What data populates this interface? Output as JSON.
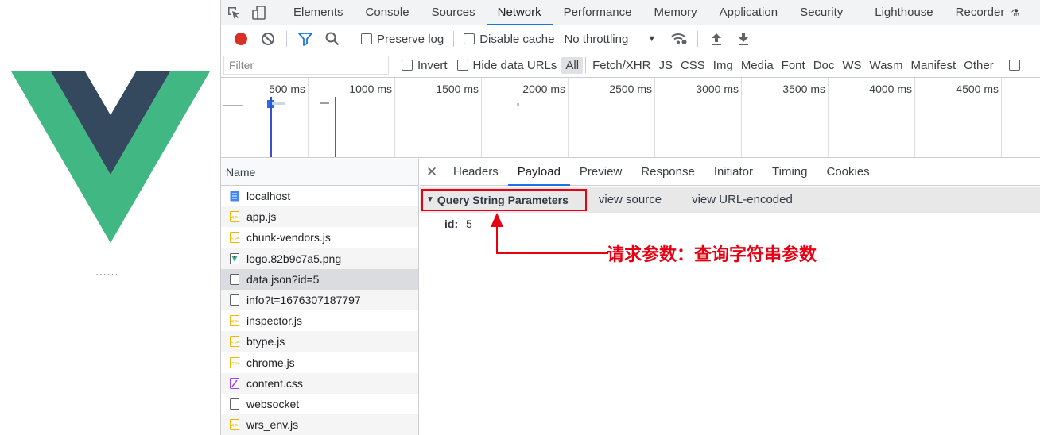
{
  "app": {
    "text": "......"
  },
  "devtools": {
    "tabs": [
      "Elements",
      "Console",
      "Sources",
      "Network",
      "Performance",
      "Memory",
      "Application",
      "Security",
      "Lighthouse",
      "Recorder"
    ],
    "active_tab": "Network",
    "toolbar": {
      "preserve_log": "Preserve log",
      "disable_cache": "Disable cache",
      "throttling": "No throttling"
    },
    "filter": {
      "placeholder": "Filter",
      "invert": "Invert",
      "hide_data_urls": "Hide data URLs",
      "types": [
        "All",
        "Fetch/XHR",
        "JS",
        "CSS",
        "Img",
        "Media",
        "Font",
        "Doc",
        "WS",
        "Wasm",
        "Manifest",
        "Other"
      ]
    },
    "timeline_ticks": [
      "500 ms",
      "1000 ms",
      "1500 ms",
      "2000 ms",
      "2500 ms",
      "3000 ms",
      "3500 ms",
      "4000 ms",
      "4500 ms"
    ],
    "name_header": "Name",
    "requests": [
      {
        "name": "localhost",
        "type": "doc"
      },
      {
        "name": "app.js",
        "type": "script"
      },
      {
        "name": "chunk-vendors.js",
        "type": "script"
      },
      {
        "name": "logo.82b9c7a5.png",
        "type": "image"
      },
      {
        "name": "data.json?id=5",
        "type": "xhr"
      },
      {
        "name": "info?t=1676307187797",
        "type": "xhr"
      },
      {
        "name": "inspector.js",
        "type": "script"
      },
      {
        "name": "btype.js",
        "type": "script"
      },
      {
        "name": "chrome.js",
        "type": "script"
      },
      {
        "name": "content.css",
        "type": "stylesheet"
      },
      {
        "name": "websocket",
        "type": "ws"
      },
      {
        "name": "wrs_env.js",
        "type": "script"
      }
    ],
    "detail_tabs": [
      "Headers",
      "Payload",
      "Preview",
      "Response",
      "Initiator",
      "Timing",
      "Cookies"
    ],
    "active_detail_tab": "Payload",
    "section": {
      "title": "Query String Parameters",
      "view_source": "view source",
      "view_url_encoded": "view URL-encoded"
    },
    "params": [
      {
        "key": "id:",
        "value": "5"
      }
    ]
  },
  "annotation": {
    "text": "请求参数：查询字符串参数",
    "color": "#e60012"
  }
}
